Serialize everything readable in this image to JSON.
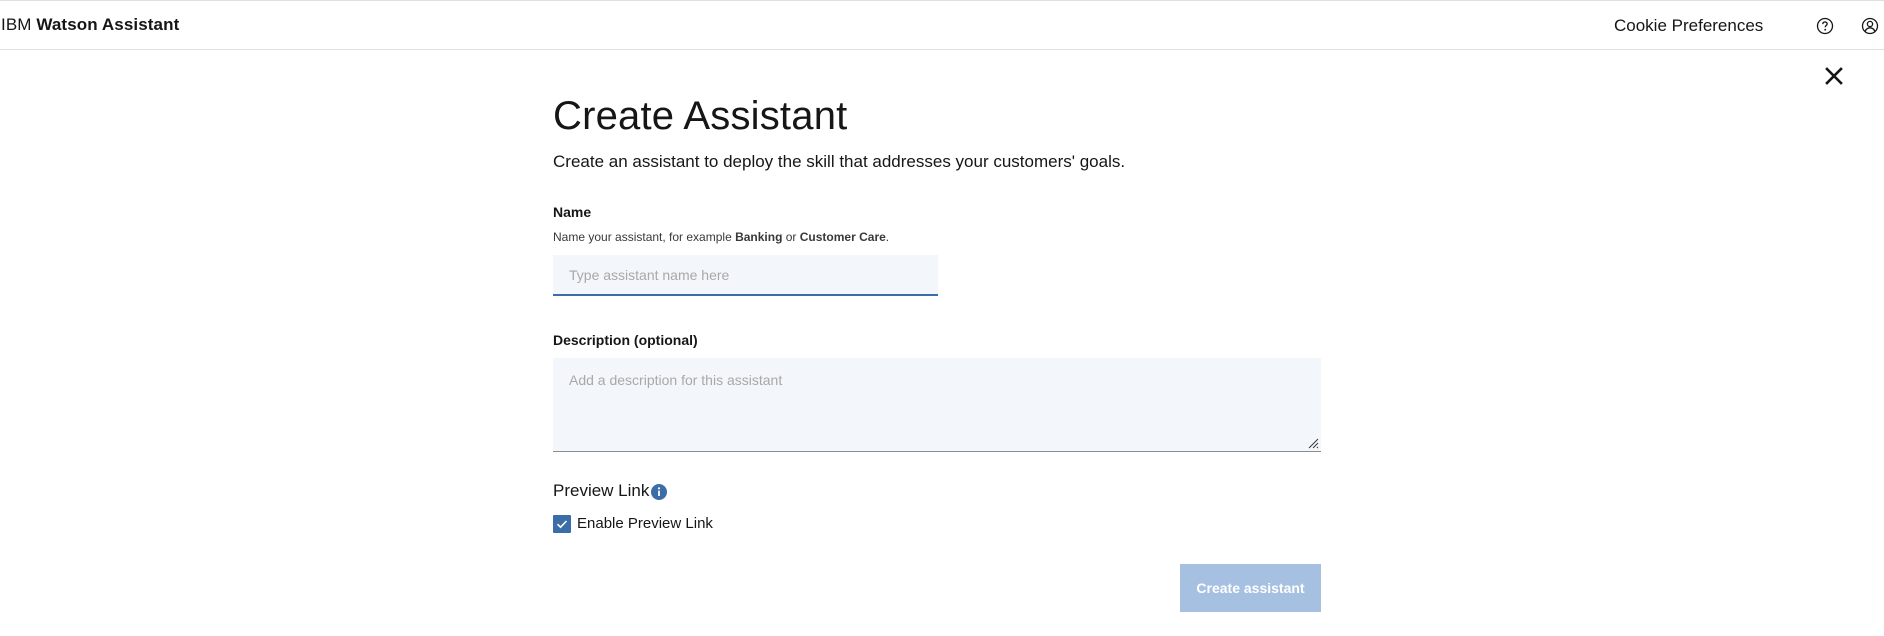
{
  "header": {
    "brand_prefix": "IBM",
    "brand_product": "Watson Assistant",
    "cookie_label": "Cookie Preferences",
    "help_icon": "help-icon",
    "user_icon": "user-avatar-icon"
  },
  "dialog": {
    "close_icon": "close-icon",
    "title": "Create Assistant",
    "subtitle": "Create an assistant to deploy the skill that addresses your customers' goals."
  },
  "name_field": {
    "label": "Name",
    "helper_prefix": "Name your assistant, for example ",
    "helper_example1": "Banking",
    "helper_or": " or ",
    "helper_example2": "Customer Care",
    "helper_suffix": ".",
    "placeholder": "Type assistant name here",
    "value": ""
  },
  "description_field": {
    "label": "Description (optional)",
    "placeholder": "Add a description for this assistant",
    "value": ""
  },
  "preview_link": {
    "title": "Preview Link",
    "info_icon": "info-icon",
    "checkbox_label": "Enable Preview Link",
    "checked": true
  },
  "actions": {
    "create_label": "Create assistant"
  },
  "colors": {
    "accent": "#3b6ea8",
    "button_disabled": "#a6c0e1",
    "field_bg": "#f3f6fa"
  }
}
